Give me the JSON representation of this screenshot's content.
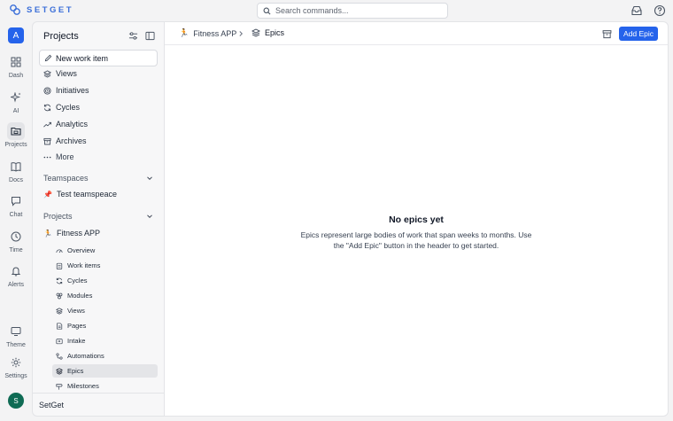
{
  "app": {
    "brand": "SETGET"
  },
  "search": {
    "placeholder": "Search commands..."
  },
  "rail": {
    "workspace_initial": "A",
    "items": [
      {
        "label": "Dash"
      },
      {
        "label": "AI"
      },
      {
        "label": "Projects"
      },
      {
        "label": "Docs"
      },
      {
        "label": "Chat"
      },
      {
        "label": "Time"
      },
      {
        "label": "Alerts"
      }
    ],
    "bottom": [
      {
        "label": "Theme"
      },
      {
        "label": "Settings"
      }
    ],
    "user_initial": "S"
  },
  "sidebar": {
    "title": "Projects",
    "new_item": "New work item",
    "nav": [
      {
        "label": "Views",
        "icon": "layers-icon"
      },
      {
        "label": "Initiatives",
        "icon": "target-icon"
      },
      {
        "label": "Cycles",
        "icon": "cycle-icon"
      },
      {
        "label": "Analytics",
        "icon": "trend-icon"
      },
      {
        "label": "Archives",
        "icon": "archive-icon"
      },
      {
        "label": "More",
        "icon": "more-icon"
      }
    ],
    "teamspaces_label": "Teamspaces",
    "teamspace": {
      "label": "Test teamspeace",
      "icon": "pushpin"
    },
    "projects_label": "Projects",
    "project": {
      "label": "Fitness APP",
      "icon": "runner"
    },
    "project_items": [
      {
        "label": "Overview"
      },
      {
        "label": "Work items"
      },
      {
        "label": "Cycles"
      },
      {
        "label": "Modules"
      },
      {
        "label": "Views"
      },
      {
        "label": "Pages"
      },
      {
        "label": "Intake"
      },
      {
        "label": "Automations"
      },
      {
        "label": "Epics",
        "active": true
      },
      {
        "label": "Milestones"
      }
    ],
    "footer": "SetGet"
  },
  "header": {
    "breadcrumb_project": "Fitness APP",
    "breadcrumb_page": "Epics",
    "add_button": "Add Epic"
  },
  "empty_state": {
    "title": "No epics yet",
    "description": "Epics represent large bodies of work that span weeks to months. Use the \"Add Epic\" button in the header to get started."
  },
  "colors": {
    "accent": "#2563eb",
    "brand": "#3b6fd9",
    "user_avatar": "#0f6b54"
  }
}
